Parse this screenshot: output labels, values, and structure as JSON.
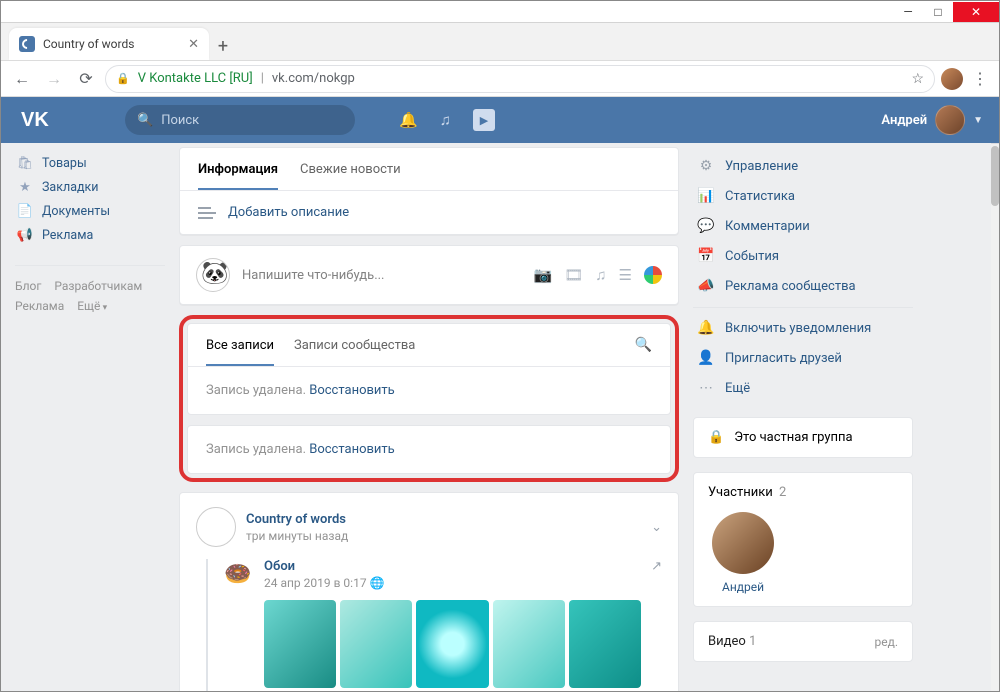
{
  "browser": {
    "tab_title": "Country of words",
    "url_secure_label": "V Kontakte LLC [RU]",
    "url_path": "vk.com/nokgp"
  },
  "header": {
    "search_placeholder": "Поиск",
    "user_name": "Андрей"
  },
  "left_nav": {
    "items": [
      {
        "icon": "🛍",
        "label": "Товары"
      },
      {
        "icon": "★",
        "label": "Закладки"
      },
      {
        "icon": "📄",
        "label": "Документы"
      },
      {
        "icon": "📢",
        "label": "Реклама"
      }
    ],
    "footer": [
      "Блог",
      "Разработчикам",
      "Реклама"
    ],
    "footer_more": "Ещё"
  },
  "info_tabs": {
    "info": "Информация",
    "news": "Свежие новости"
  },
  "add_description": "Добавить описание",
  "newpost_placeholder": "Напишите что-нибудь...",
  "wall_tabs": {
    "all": "Все записи",
    "community": "Записи сообщества"
  },
  "deleted1": {
    "text": "Запись удалена. ",
    "restore": "Восстановить"
  },
  "deleted2": {
    "text": "Запись удалена. ",
    "restore": "Восстановить"
  },
  "post": {
    "author": "Country of words",
    "time": "три минуты назад",
    "repost_from": "Обои",
    "repost_time": "24 апр 2019 в 0:17"
  },
  "right": {
    "manage": "Управление",
    "stats": "Статистика",
    "comments": "Комментарии",
    "events": "События",
    "ads": "Реклама сообщества",
    "notify": "Включить уведомления",
    "invite": "Пригласить друзей",
    "more": "Ещё",
    "private_label": "Это частная группа",
    "members_title": "Участники",
    "members_count": "2",
    "member1": "Андрей",
    "videos_title": "Видео",
    "videos_count": "1",
    "videos_edit": "ред."
  }
}
